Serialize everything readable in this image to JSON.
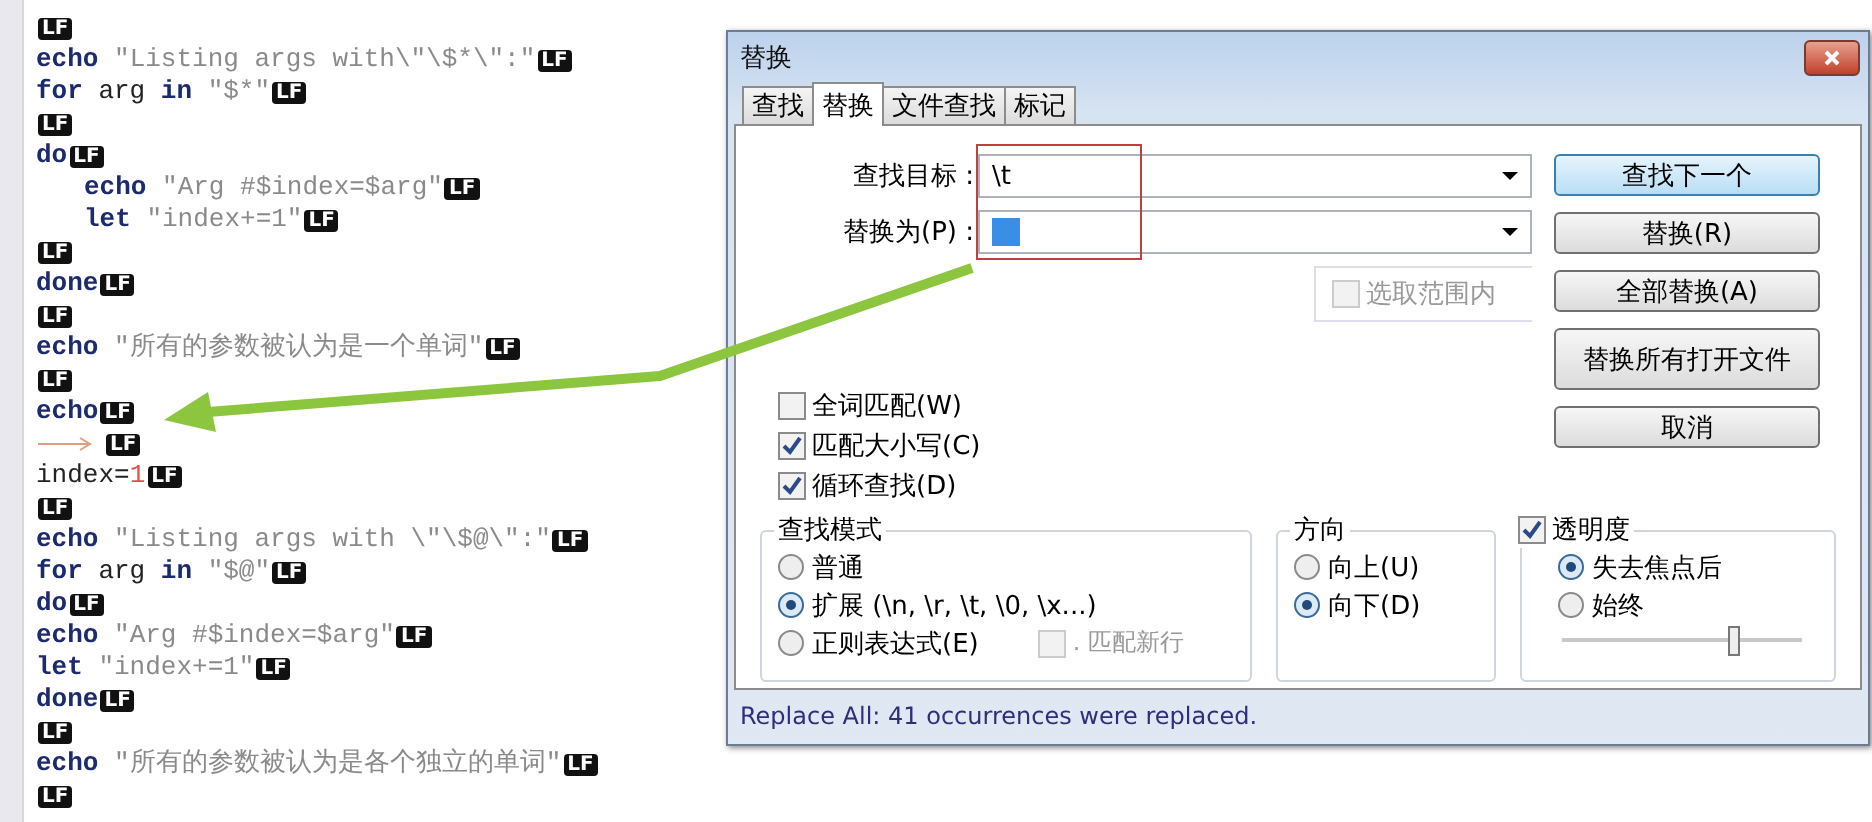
{
  "editor": {
    "lines": [
      {
        "eol": "LF"
      },
      {
        "eol": "LF",
        "tokens": [
          {
            "kind": "keyword",
            "text": "echo"
          },
          {
            "kind": "string",
            "text": " \"Listing args with\\\"\\$*\\\":\""
          }
        ]
      },
      {
        "eol": "LF",
        "tokens": [
          {
            "kind": "keyword",
            "text": "for"
          },
          {
            "kind": "plain",
            "text": " arg "
          },
          {
            "kind": "keyword",
            "text": "in"
          },
          {
            "kind": "string",
            "text": " \"$*\""
          }
        ]
      },
      {
        "eol": "LF"
      },
      {
        "eol": "LF",
        "tokens": [
          {
            "kind": "keyword",
            "text": "do"
          }
        ]
      },
      {
        "eol": "LF",
        "tokens": [
          {
            "kind": "indent"
          },
          {
            "kind": "keyword",
            "text": "echo"
          },
          {
            "kind": "string",
            "text": " \"Arg #$index=$arg\""
          }
        ]
      },
      {
        "eol": "LF",
        "tokens": [
          {
            "kind": "indent"
          },
          {
            "kind": "keyword",
            "text": "let"
          },
          {
            "kind": "string",
            "text": " \"index+=1\""
          }
        ]
      },
      {
        "eol": "LF"
      },
      {
        "eol": "LF",
        "tokens": [
          {
            "kind": "keyword",
            "text": "done"
          }
        ]
      },
      {
        "eol": "LF"
      },
      {
        "eol": "LF",
        "tokens": [
          {
            "kind": "keyword",
            "text": "echo"
          },
          {
            "kind": "string",
            "text": " \"所有的参数被认为是一个单词\""
          }
        ]
      },
      {
        "eol": "LF"
      },
      {
        "eol": "LF",
        "tokens": [
          {
            "kind": "keyword",
            "text": "echo"
          }
        ]
      },
      {
        "eol": "LF",
        "tokens": [
          {
            "kind": "tab"
          }
        ]
      },
      {
        "eol": "LF",
        "tokens": [
          {
            "kind": "plain",
            "text": "index="
          },
          {
            "kind": "number",
            "text": "1"
          }
        ]
      },
      {
        "eol": "LF"
      },
      {
        "eol": "LF",
        "tokens": [
          {
            "kind": "keyword",
            "text": "echo"
          },
          {
            "kind": "string",
            "text": " \"Listing args with \\\"\\$@\\\":\""
          }
        ]
      },
      {
        "eol": "LF",
        "tokens": [
          {
            "kind": "keyword",
            "text": "for"
          },
          {
            "kind": "plain",
            "text": " arg "
          },
          {
            "kind": "keyword",
            "text": "in"
          },
          {
            "kind": "string",
            "text": " \"$@\""
          }
        ]
      },
      {
        "eol": "LF",
        "tokens": [
          {
            "kind": "keyword",
            "text": "do"
          }
        ]
      },
      {
        "eol": "LF",
        "tokens": [
          {
            "kind": "keyword",
            "text": "echo"
          },
          {
            "kind": "string",
            "text": " \"Arg #$index=$arg\""
          }
        ]
      },
      {
        "eol": "LF",
        "tokens": [
          {
            "kind": "keyword",
            "text": "let"
          },
          {
            "kind": "string",
            "text": " \"index+=1\""
          }
        ]
      },
      {
        "eol": "LF",
        "tokens": [
          {
            "kind": "keyword",
            "text": "done"
          }
        ]
      },
      {
        "eol": "LF"
      },
      {
        "eol": "LF",
        "tokens": [
          {
            "kind": "keyword",
            "text": "echo"
          },
          {
            "kind": "string",
            "text": " \"所有的参数被认为是各个独立的单词\""
          }
        ]
      },
      {
        "eol": "LF"
      }
    ]
  },
  "dialog": {
    "title": "替换",
    "tabs": [
      {
        "label": "查找",
        "selected": false
      },
      {
        "label": "替换",
        "selected": true
      },
      {
        "label": "文件查找",
        "selected": false
      },
      {
        "label": "标记",
        "selected": false
      }
    ],
    "find_field": {
      "label": "查找目标 :",
      "value": "\\t"
    },
    "replace_field": {
      "label": "替换为(P) :",
      "selection_highlight": true
    },
    "buttons": [
      {
        "label": "查找下一个",
        "default": true
      },
      {
        "label": "替换(R)",
        "default": false
      },
      {
        "label": "全部替换(A)",
        "default": false
      },
      {
        "label": "替换所有打开文件",
        "default": false
      },
      {
        "label": "取消",
        "default": false
      }
    ],
    "in_selection": {
      "label": "选取范围内",
      "checked": false,
      "disabled": true
    },
    "options": [
      {
        "label": "全词匹配(W)",
        "checked": false
      },
      {
        "label": "匹配大小写(C)",
        "checked": true
      },
      {
        "label": "循环查找(D)",
        "checked": true
      }
    ],
    "search_mode": {
      "title": "查找模式",
      "options": [
        {
          "label": "普通",
          "selected": false
        },
        {
          "label": "扩展 (\\n, \\r, \\t, \\0, \\x...)",
          "selected": true
        },
        {
          "label": "正则表达式(E)",
          "selected": false
        }
      ],
      "dot_newline": {
        "label": ". 匹配新行",
        "checked": false,
        "disabled": true
      }
    },
    "direction": {
      "title": "方向",
      "options": [
        {
          "label": "向上(U)",
          "selected": false
        },
        {
          "label": "向下(D)",
          "selected": true
        }
      ]
    },
    "transparency": {
      "label": "透明度",
      "checked": true,
      "options": [
        {
          "label": "失去焦点后",
          "selected": true
        },
        {
          "label": "始终",
          "selected": false
        }
      ],
      "level": 0.72
    },
    "status": "Replace All: 41 occurrences were replaced."
  }
}
